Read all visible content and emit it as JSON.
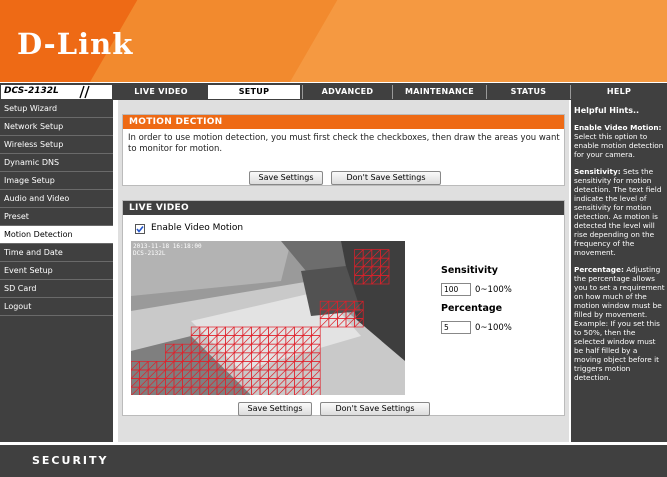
{
  "brand": {
    "logo_text": "D-Link",
    "model": "DCS-2132L"
  },
  "nav": {
    "tabs": [
      {
        "label": "LIVE VIDEO"
      },
      {
        "label": "SETUP"
      },
      {
        "label": "ADVANCED"
      },
      {
        "label": "MAINTENANCE"
      },
      {
        "label": "STATUS"
      },
      {
        "label": "HELP"
      }
    ],
    "active_tab": "SETUP"
  },
  "sidebar": {
    "items": [
      {
        "label": "Setup Wizard"
      },
      {
        "label": "Network Setup"
      },
      {
        "label": "Wireless Setup"
      },
      {
        "label": "Dynamic DNS"
      },
      {
        "label": "Image Setup"
      },
      {
        "label": "Audio and Video"
      },
      {
        "label": "Preset"
      },
      {
        "label": "Motion Detection"
      },
      {
        "label": "Time and Date"
      },
      {
        "label": "Event Setup"
      },
      {
        "label": "SD Card"
      },
      {
        "label": "Logout"
      }
    ],
    "active_item": "Motion Detection"
  },
  "motion": {
    "title": "MOTION DECTION",
    "message": "In order to use motion detection, you must first check the checkboxes, then draw the areas you want to monitor for motion.",
    "save_label": "Save Settings",
    "dont_save_label": "Don't Save Settings"
  },
  "live": {
    "title": "LIVE VIDEO",
    "enable_label": "Enable Video Motion",
    "enable_checked": true,
    "overlay_line1": "2013-11-18 16:18:00",
    "overlay_line2": "DCS-2132L",
    "sensitivity_label": "Sensitivity",
    "sensitivity_value": "100",
    "sensitivity_range": "0~100%",
    "percentage_label": "Percentage",
    "percentage_value": "5",
    "percentage_range": "0~100%"
  },
  "bottom": {
    "save_label": "Save Settings",
    "dont_save_label": "Don't Save Settings"
  },
  "hints": {
    "title": "Helpful Hints..",
    "h1_bold": "Enable Video Motion:",
    "h1_text": "Select this option to enable motion detection for your camera.",
    "h2_bold": "Sensitivity:",
    "h2_text": "Sets the sensitivity for motion detection. The text field indicate the level of sensitivity for motion detection. As motion is detected the level will rise depending on the frequency of the movement.",
    "h3_bold": "Percentage:",
    "h3_text": "Adjusting the percentage allows you to set a requirement on how much of the motion window must be filled by movement. Example: If you set this to 50%, then the selected window must be half filled by a moving object before it triggers motion detection."
  },
  "footer": {
    "label": "SECURITY"
  },
  "colors": {
    "orange": "#ee6a15",
    "dark": "#404040",
    "section_head": "#404040",
    "motion_head": "#ee6a15",
    "grid": "#e0202a"
  }
}
